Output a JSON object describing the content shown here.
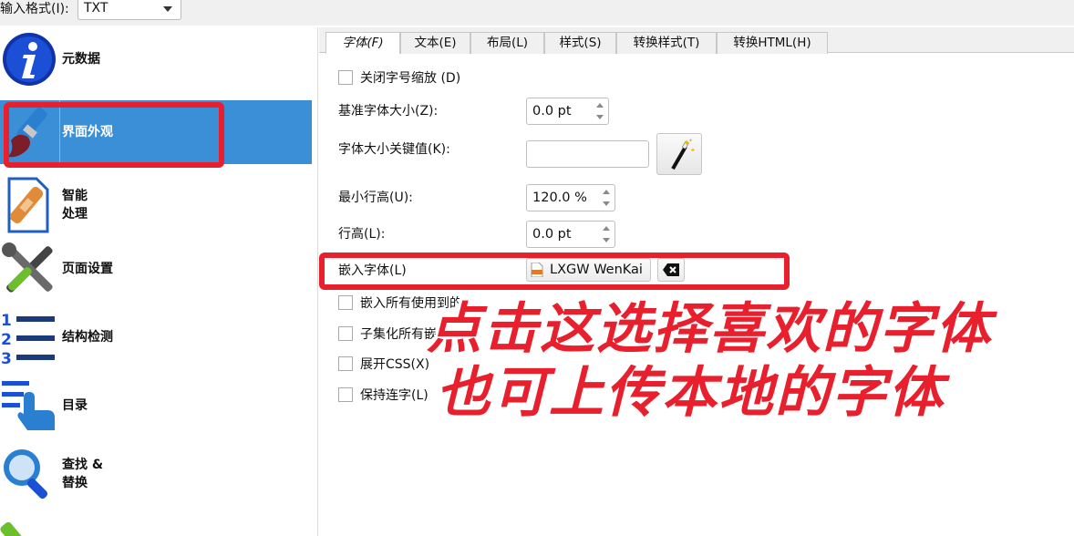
{
  "topbar": {
    "label": "输入格式(I):",
    "format_value": "TXT"
  },
  "sidebar": {
    "items": [
      {
        "label": "元数据",
        "icon": "info-icon"
      },
      {
        "label": "界面外观",
        "icon": "paintbrush-icon",
        "active": true
      },
      {
        "label": "智能\n处理",
        "icon": "bandage-document-icon"
      },
      {
        "label": "页面设置",
        "icon": "tools-icon"
      },
      {
        "label": "结构检测",
        "icon": "numbered-list-icon"
      },
      {
        "label": "目录",
        "icon": "toc-pointer-icon"
      },
      {
        "label": "查找 &\n替换",
        "icon": "magnifier-icon"
      }
    ]
  },
  "tabs": [
    "字体(F)",
    "文本(E)",
    "布局(L)",
    "样式(S)",
    "转换样式(T)",
    "转换HTML(H)"
  ],
  "form": {
    "disable_font_scaling": "关闭字号缩放 (D)",
    "base_font_size_label": "基准字体大小(Z):",
    "base_font_size_value": "0.0 pt",
    "font_size_key_label": "字体大小关键值(K):",
    "font_size_key_value": "",
    "min_line_height_label": "最小行高(U):",
    "min_line_height_value": "120.0 %",
    "line_height_label": "行高(L):",
    "line_height_value": "0.0 pt",
    "embed_font_label": "嵌入字体(L)",
    "embed_font_value": "LXGW WenKai",
    "embed_all_fonts": "嵌入所有使用到的",
    "subset_fonts": "子集化所有嵌",
    "expand_css": "展开CSS(X)",
    "keep_ligatures": "保持连字(L)"
  },
  "annotation": {
    "line1": "点击这选择喜欢的字体",
    "line2": "也可上传本地的字体",
    "color": "#e8202e"
  },
  "colors": {
    "sidebar_active": "#3b8fd6",
    "highlight_red": "#e8202e"
  }
}
